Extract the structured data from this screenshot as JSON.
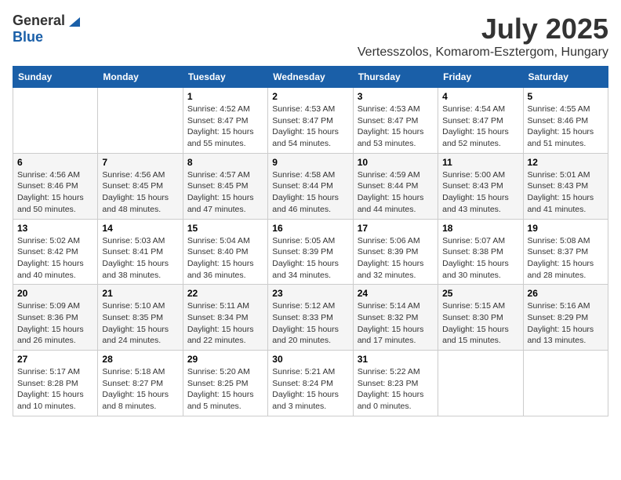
{
  "logo": {
    "general": "General",
    "blue": "Blue"
  },
  "title": {
    "month_year": "July 2025",
    "location": "Vertesszolos, Komarom-Esztergom, Hungary"
  },
  "calendar": {
    "headers": [
      "Sunday",
      "Monday",
      "Tuesday",
      "Wednesday",
      "Thursday",
      "Friday",
      "Saturday"
    ],
    "weeks": [
      [
        {
          "day": "",
          "info": ""
        },
        {
          "day": "",
          "info": ""
        },
        {
          "day": "1",
          "info": "Sunrise: 4:52 AM\nSunset: 8:47 PM\nDaylight: 15 hours and 55 minutes."
        },
        {
          "day": "2",
          "info": "Sunrise: 4:53 AM\nSunset: 8:47 PM\nDaylight: 15 hours and 54 minutes."
        },
        {
          "day": "3",
          "info": "Sunrise: 4:53 AM\nSunset: 8:47 PM\nDaylight: 15 hours and 53 minutes."
        },
        {
          "day": "4",
          "info": "Sunrise: 4:54 AM\nSunset: 8:47 PM\nDaylight: 15 hours and 52 minutes."
        },
        {
          "day": "5",
          "info": "Sunrise: 4:55 AM\nSunset: 8:46 PM\nDaylight: 15 hours and 51 minutes."
        }
      ],
      [
        {
          "day": "6",
          "info": "Sunrise: 4:56 AM\nSunset: 8:46 PM\nDaylight: 15 hours and 50 minutes."
        },
        {
          "day": "7",
          "info": "Sunrise: 4:56 AM\nSunset: 8:45 PM\nDaylight: 15 hours and 48 minutes."
        },
        {
          "day": "8",
          "info": "Sunrise: 4:57 AM\nSunset: 8:45 PM\nDaylight: 15 hours and 47 minutes."
        },
        {
          "day": "9",
          "info": "Sunrise: 4:58 AM\nSunset: 8:44 PM\nDaylight: 15 hours and 46 minutes."
        },
        {
          "day": "10",
          "info": "Sunrise: 4:59 AM\nSunset: 8:44 PM\nDaylight: 15 hours and 44 minutes."
        },
        {
          "day": "11",
          "info": "Sunrise: 5:00 AM\nSunset: 8:43 PM\nDaylight: 15 hours and 43 minutes."
        },
        {
          "day": "12",
          "info": "Sunrise: 5:01 AM\nSunset: 8:43 PM\nDaylight: 15 hours and 41 minutes."
        }
      ],
      [
        {
          "day": "13",
          "info": "Sunrise: 5:02 AM\nSunset: 8:42 PM\nDaylight: 15 hours and 40 minutes."
        },
        {
          "day": "14",
          "info": "Sunrise: 5:03 AM\nSunset: 8:41 PM\nDaylight: 15 hours and 38 minutes."
        },
        {
          "day": "15",
          "info": "Sunrise: 5:04 AM\nSunset: 8:40 PM\nDaylight: 15 hours and 36 minutes."
        },
        {
          "day": "16",
          "info": "Sunrise: 5:05 AM\nSunset: 8:39 PM\nDaylight: 15 hours and 34 minutes."
        },
        {
          "day": "17",
          "info": "Sunrise: 5:06 AM\nSunset: 8:39 PM\nDaylight: 15 hours and 32 minutes."
        },
        {
          "day": "18",
          "info": "Sunrise: 5:07 AM\nSunset: 8:38 PM\nDaylight: 15 hours and 30 minutes."
        },
        {
          "day": "19",
          "info": "Sunrise: 5:08 AM\nSunset: 8:37 PM\nDaylight: 15 hours and 28 minutes."
        }
      ],
      [
        {
          "day": "20",
          "info": "Sunrise: 5:09 AM\nSunset: 8:36 PM\nDaylight: 15 hours and 26 minutes."
        },
        {
          "day": "21",
          "info": "Sunrise: 5:10 AM\nSunset: 8:35 PM\nDaylight: 15 hours and 24 minutes."
        },
        {
          "day": "22",
          "info": "Sunrise: 5:11 AM\nSunset: 8:34 PM\nDaylight: 15 hours and 22 minutes."
        },
        {
          "day": "23",
          "info": "Sunrise: 5:12 AM\nSunset: 8:33 PM\nDaylight: 15 hours and 20 minutes."
        },
        {
          "day": "24",
          "info": "Sunrise: 5:14 AM\nSunset: 8:32 PM\nDaylight: 15 hours and 17 minutes."
        },
        {
          "day": "25",
          "info": "Sunrise: 5:15 AM\nSunset: 8:30 PM\nDaylight: 15 hours and 15 minutes."
        },
        {
          "day": "26",
          "info": "Sunrise: 5:16 AM\nSunset: 8:29 PM\nDaylight: 15 hours and 13 minutes."
        }
      ],
      [
        {
          "day": "27",
          "info": "Sunrise: 5:17 AM\nSunset: 8:28 PM\nDaylight: 15 hours and 10 minutes."
        },
        {
          "day": "28",
          "info": "Sunrise: 5:18 AM\nSunset: 8:27 PM\nDaylight: 15 hours and 8 minutes."
        },
        {
          "day": "29",
          "info": "Sunrise: 5:20 AM\nSunset: 8:25 PM\nDaylight: 15 hours and 5 minutes."
        },
        {
          "day": "30",
          "info": "Sunrise: 5:21 AM\nSunset: 8:24 PM\nDaylight: 15 hours and 3 minutes."
        },
        {
          "day": "31",
          "info": "Sunrise: 5:22 AM\nSunset: 8:23 PM\nDaylight: 15 hours and 0 minutes."
        },
        {
          "day": "",
          "info": ""
        },
        {
          "day": "",
          "info": ""
        }
      ]
    ]
  }
}
